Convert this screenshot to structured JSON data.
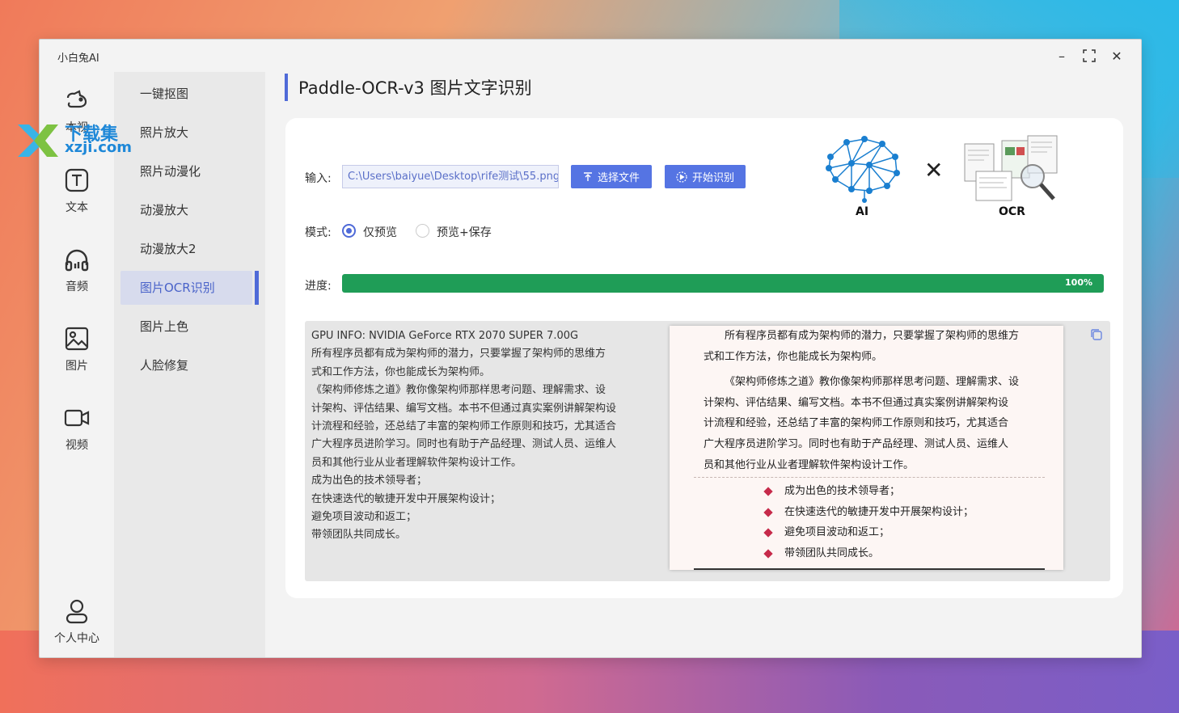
{
  "window": {
    "title": "小白兔AI",
    "controls": {
      "minimize": "–",
      "maximize": "⛶",
      "close": "✕"
    }
  },
  "nav_rail": [
    {
      "label": "本视",
      "icon": "cat-icon"
    },
    {
      "label": "文本",
      "icon": "text-t-icon"
    },
    {
      "label": "音频",
      "icon": "headphones-icon"
    },
    {
      "label": "图片",
      "icon": "image-icon"
    },
    {
      "label": "视频",
      "icon": "video-camera-icon"
    }
  ],
  "user_center": {
    "label": "个人中心",
    "icon": "user-icon"
  },
  "subnav": [
    {
      "label": "一键抠图"
    },
    {
      "label": "照片放大"
    },
    {
      "label": "照片动漫化"
    },
    {
      "label": "动漫放大"
    },
    {
      "label": "动漫放大2"
    },
    {
      "label": "图片OCR识别",
      "active": true
    },
    {
      "label": "图片上色"
    },
    {
      "label": "人脸修复"
    }
  ],
  "main": {
    "heading": "Paddle-OCR-v3 图片文字识别",
    "input_label": "输入:",
    "input_value": "C:\\Users\\baiyue\\Desktop\\rife测试\\55.png",
    "select_file_button": "选择文件",
    "start_button": "开始识别",
    "mode_label": "模式:",
    "modes": [
      {
        "label": "仅预览",
        "selected": true
      },
      {
        "label": "预览+保存",
        "selected": false
      }
    ],
    "progress_label": "进度:",
    "progress_value": 1.0,
    "progress_text": "100%",
    "logo_ai_text": "AI",
    "logo_x_text": "✕",
    "logo_ocr_text": "OCR"
  },
  "result": {
    "lines": [
      "GPU INFO: NVIDIA GeForce RTX 2070 SUPER 7.00G",
      "所有程序员都有成为架构师的潜力，只要掌握了架构师的思维方",
      "式和工作方法，你也能成长为架构师。",
      "《架构师修炼之道》教你像架构师那样思考问题、理解需求、设",
      "计架构、评估结果、编写文档。本书不但通过真实案例讲解架构设",
      "计流程和经验，还总结了丰富的架构师工作原则和技巧，尤其适合",
      "广大程序员进阶学习。同时也有助于产品经理、测试人员、运维人",
      "员和其他行业从业者理解软件架构设计工作。",
      "成为出色的技术领导者；",
      "在快速迭代的敏捷开发中开展架构设计；",
      "避免项目波动和返工；",
      "带领团队共同成长。"
    ]
  },
  "preview_doc": {
    "para1": [
      "所有程序员都有成为架构师的潜力，只要掌握了架构师的思维方",
      "式和工作方法，你也能成长为架构师。"
    ],
    "para2": [
      "《架构师修炼之道》教你像架构师那样思考问题、理解需求、设",
      "计架构、评估结果、编写文档。本书不但通过真实案例讲解架构设",
      "计流程和经验，还总结了丰富的架构师工作原则和技巧，尤其适合",
      "广大程序员进阶学习。同时也有助于产品经理、测试人员、运维人",
      "员和其他行业从业者理解软件架构设计工作。"
    ],
    "bullets": [
      "成为出色的技术领导者；",
      "在快速迭代的敏捷开发中开展架构设计；",
      "避免项目波动和返工；",
      "带领团队共同成长。"
    ]
  },
  "watermark": {
    "line1": "下载集",
    "line2": "xzji.com"
  },
  "colors": {
    "accent": "#4f6ad8",
    "progress": "#1f9d57",
    "button": "#5574e3"
  }
}
